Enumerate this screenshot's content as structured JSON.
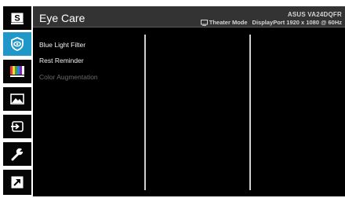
{
  "header": {
    "title": "Eye Care",
    "model": "ASUS VA24DQFR",
    "mode": "Theater Mode",
    "input_info": "DisplayPort 1920 x 1080 @ 60Hz"
  },
  "menu": {
    "items": [
      {
        "label": "Blue Light Filter",
        "enabled": true
      },
      {
        "label": "Rest Reminder",
        "enabled": true
      },
      {
        "label": "Color Augmentation",
        "enabled": false
      }
    ]
  },
  "sidebar": {
    "items": [
      {
        "name": "splendid",
        "icon": "splendid-s-icon",
        "active": false
      },
      {
        "name": "eye-care",
        "icon": "eye-icon",
        "active": true
      },
      {
        "name": "color",
        "icon": "color-bars-icon",
        "active": false
      },
      {
        "name": "image",
        "icon": "landscape-image-icon",
        "active": false
      },
      {
        "name": "input-select",
        "icon": "input-arrow-icon",
        "active": false
      },
      {
        "name": "system-setup",
        "icon": "wrench-icon",
        "active": false
      },
      {
        "name": "shortcut",
        "icon": "shortcut-arrow-icon",
        "active": false
      }
    ]
  },
  "colors": {
    "accent": "#1f98c9",
    "panel": "#000000",
    "header": "#333333",
    "disabled_text": "#6a6a6a"
  }
}
